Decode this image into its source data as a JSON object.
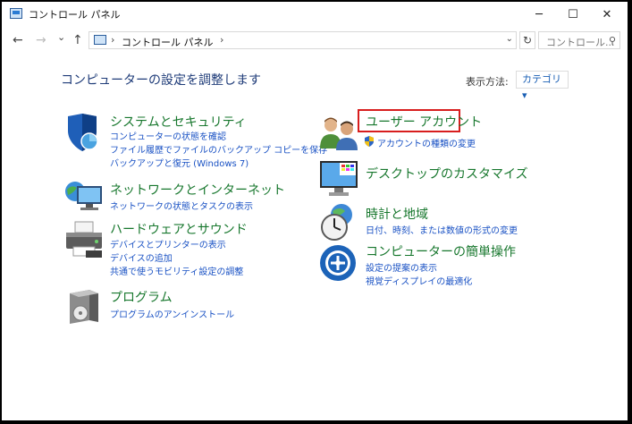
{
  "window": {
    "title": "コントロール パネル",
    "minimize_glyph": "─",
    "maximize_glyph": "☐",
    "close_glyph": "✕"
  },
  "nav": {
    "back_glyph": "←",
    "forward_glyph": "→",
    "recent_glyph": "⌄",
    "up_glyph": "↑",
    "breadcrumb_sep": "›",
    "breadcrumb": "コントロール パネル",
    "address_dropdown_glyph": "⌄",
    "refresh_glyph": "↻",
    "search_placeholder": "コントロール...",
    "search_glyph": "⚲"
  },
  "header": {
    "title": "コンピューターの設定を調整します",
    "view_by_label": "表示方法:",
    "view_by_value": "カテゴリ ▾"
  },
  "categories_left": [
    {
      "title": "システムとセキュリティ",
      "icon": "shield-icon",
      "links": [
        "コンピューターの状態を確認",
        "ファイル履歴でファイルのバックアップ コピーを保存",
        "バックアップと復元 (Windows 7)"
      ]
    },
    {
      "title": "ネットワークとインターネット",
      "icon": "network-icon",
      "links": [
        "ネットワークの状態とタスクの表示"
      ]
    },
    {
      "title": "ハードウェアとサウンド",
      "icon": "printer-icon",
      "links": [
        "デバイスとプリンターの表示",
        "デバイスの追加",
        "共通で使うモビリティ設定の調整"
      ]
    },
    {
      "title": "プログラム",
      "icon": "program-icon",
      "links": [
        "プログラムのアンインストール"
      ]
    }
  ],
  "categories_right": [
    {
      "title": "ユーザー アカウント",
      "icon": "users-icon",
      "links": [
        "アカウントの種類の変更"
      ]
    },
    {
      "title": "デスクトップのカスタマイズ",
      "icon": "monitor-icon",
      "links": []
    },
    {
      "title": "時計と地域",
      "icon": "clock-globe-icon",
      "links": [
        "日付、時刻、または数値の形式の変更"
      ]
    },
    {
      "title": "コンピューターの簡単操作",
      "icon": "accessibility-icon",
      "links": [
        "設定の提案の表示",
        "視覚ディスプレイの最適化"
      ]
    }
  ],
  "colors": {
    "category_title": "#17772d",
    "link": "#1a52c4",
    "highlight_border": "#d81e1e"
  }
}
